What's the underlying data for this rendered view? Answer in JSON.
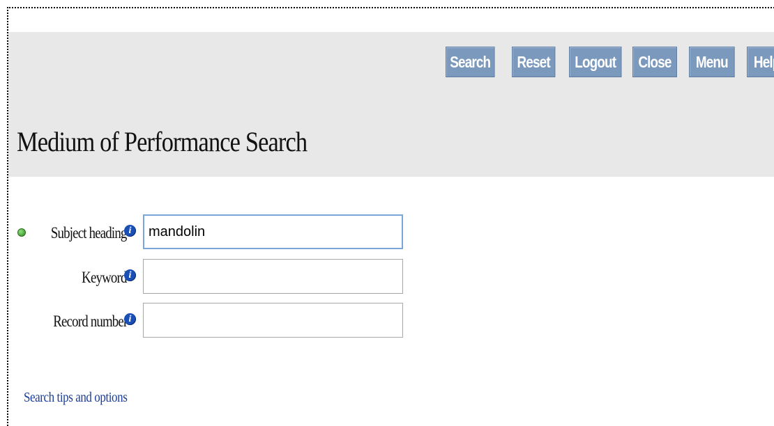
{
  "toolbar": {
    "buttons": [
      {
        "id": "search",
        "label": "Search"
      },
      {
        "id": "reset",
        "label": "Reset"
      },
      {
        "id": "logout",
        "label": "Logout"
      },
      {
        "id": "close",
        "label": "Close"
      },
      {
        "id": "menu",
        "label": "Menu"
      },
      {
        "id": "help",
        "label": "Help"
      }
    ]
  },
  "page": {
    "title": "Medium of Performance Search"
  },
  "form": {
    "subject_heading": {
      "label": "Subject heading",
      "value": "mandolin",
      "placeholder": ""
    },
    "keyword": {
      "label": "Keyword",
      "value": "",
      "placeholder": ""
    },
    "record_number": {
      "label": "Record number",
      "value": "",
      "placeholder": ""
    }
  },
  "links": {
    "search_tips": "Search tips and options"
  },
  "icons": {
    "info": "info-icon",
    "required": "required-dot-icon"
  },
  "colors": {
    "button_bg": "#7b98bd",
    "header_band": "#e8e8e8",
    "link": "#1a3d9c",
    "info_icon": "#1a4fb5",
    "required_dot": "#2c8a1f"
  }
}
